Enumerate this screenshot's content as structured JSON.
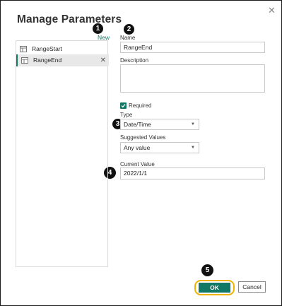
{
  "dialog": {
    "title": "Manage Parameters",
    "new_label": "New"
  },
  "parameters": [
    {
      "label": "RangeStart",
      "selected": false
    },
    {
      "label": "RangeEnd",
      "selected": true
    }
  ],
  "form": {
    "name_label": "Name",
    "name_value": "RangeEnd",
    "description_label": "Description",
    "description_value": "",
    "required_label": "Required",
    "required_checked": true,
    "type_label": "Type",
    "type_value": "Date/Time",
    "suggested_label": "Suggested Values",
    "suggested_value": "Any value",
    "current_label": "Current Value",
    "current_value": "2022/1/1"
  },
  "markers": [
    "1",
    "2",
    "3",
    "4",
    "5"
  ],
  "buttons": {
    "ok": "OK",
    "cancel": "Cancel"
  },
  "colors": {
    "accent": "#117865",
    "highlight": "#f0b400"
  },
  "icons": {
    "close": "close-icon",
    "param": "table-parameter-icon",
    "delete": "delete-x-icon",
    "dropdown": "chevron-down-icon",
    "check": "check-icon"
  }
}
